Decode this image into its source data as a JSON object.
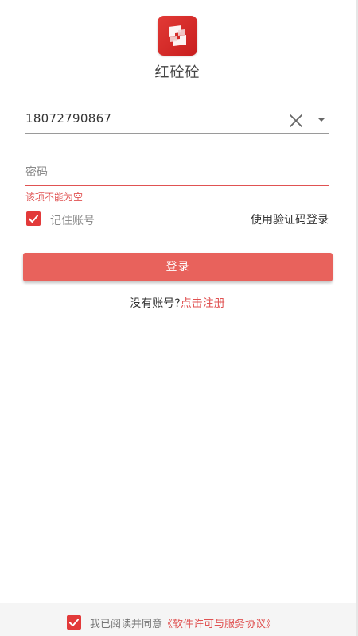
{
  "app": {
    "name": "红砼砼",
    "logo_icon": "red-brand-logo-icon"
  },
  "login_form": {
    "phone_value": "18072790867",
    "password_placeholder": "密码",
    "password_error": "该项不能为空",
    "remember_label": "记住账号",
    "remember_checked": true,
    "sms_login_label": "使用验证码登录",
    "login_button_label": "登录"
  },
  "register": {
    "prompt": "没有账号?",
    "link_label": "点击注册"
  },
  "footer": {
    "agree_checked": true,
    "agree_prefix": "我已阅读并同意",
    "agreement_link": "《软件许可与服务协议》"
  },
  "colors": {
    "accent": "#e8625c",
    "error": "#e05252",
    "checkbox": "#e23a3a"
  }
}
